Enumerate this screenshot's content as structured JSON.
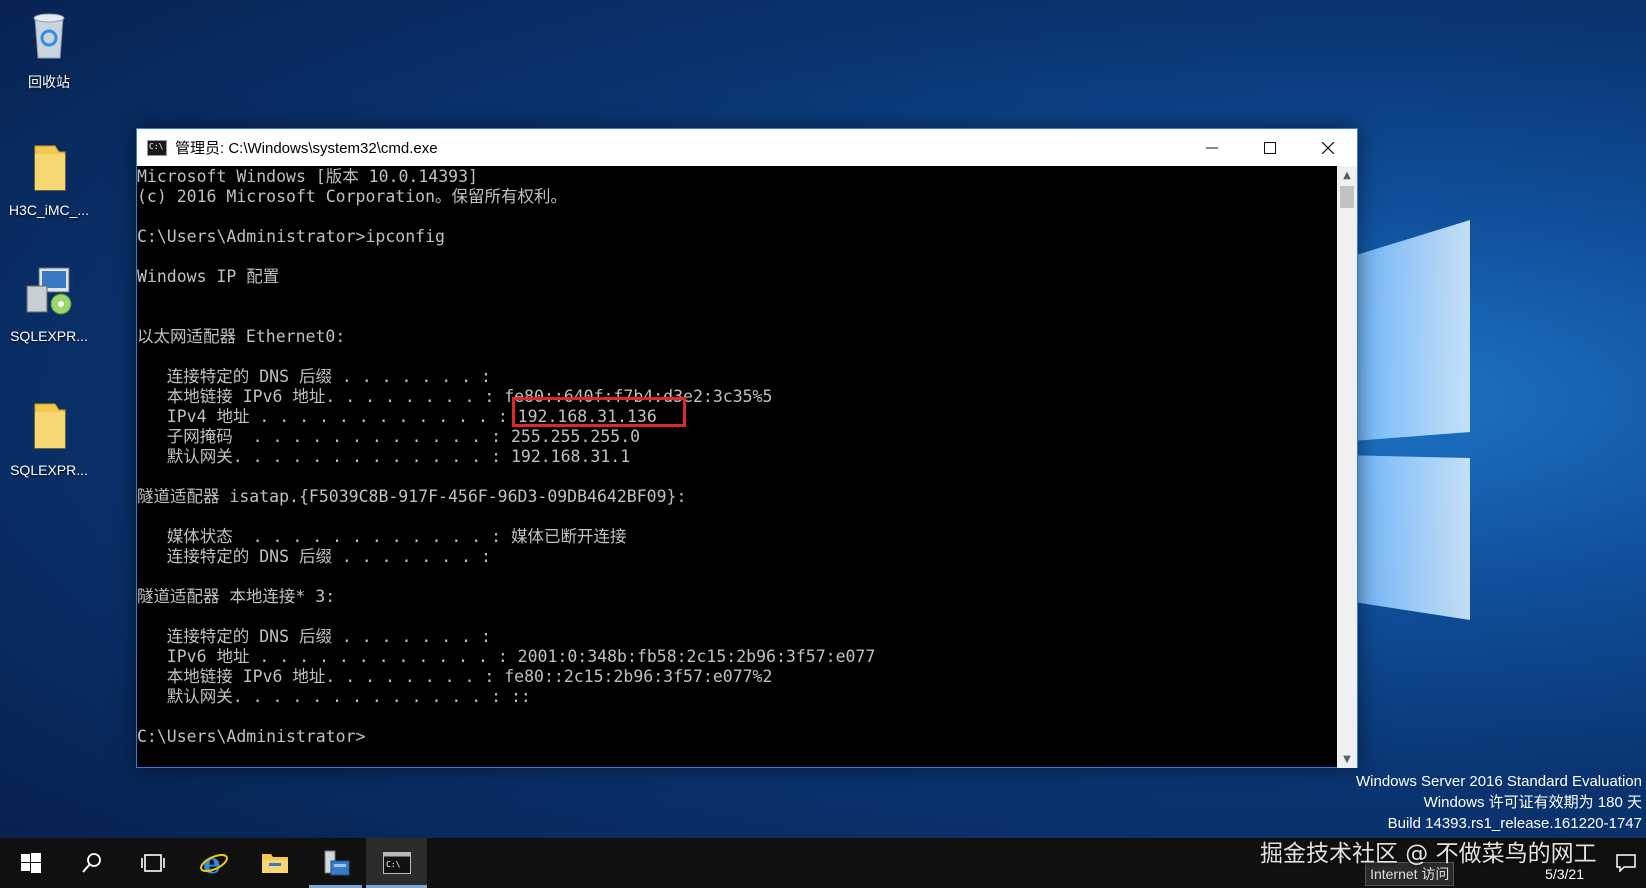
{
  "desktop": {
    "icons": [
      {
        "label": "回收站",
        "icon": "recycle-bin-icon"
      },
      {
        "label": "H3C_iMC_...",
        "icon": "folder-icon"
      },
      {
        "label": "SQLEXPR...",
        "icon": "installer-icon"
      },
      {
        "label": "SQLEXPR...",
        "icon": "folder-icon"
      }
    ],
    "system_info": [
      "Windows Server 2016 Standard Evaluation",
      "Windows 许可证有效期为 180 天",
      "Build 14393.rs1_release.161220-1747"
    ],
    "watermark": "掘金技术社区 @ 不做菜鸟的网工"
  },
  "cmd_window": {
    "title": "管理员: C:\\Windows\\system32\\cmd.exe",
    "console_lines": [
      "Microsoft Windows [版本 10.0.14393]",
      "(c) 2016 Microsoft Corporation。保留所有权利。",
      "",
      "C:\\Users\\Administrator>ipconfig",
      "",
      "Windows IP 配置",
      "",
      "",
      "以太网适配器 Ethernet0:",
      "",
      "   连接特定的 DNS 后缀 . . . . . . . :",
      "   本地链接 IPv6 地址. . . . . . . . : fe80::640f:f7b4:d3e2:3c35%5",
      "   IPv4 地址 . . . . . . . . . . . . : 192.168.31.136",
      "   子网掩码  . . . . . . . . . . . . : 255.255.255.0",
      "   默认网关. . . . . . . . . . . . . : 192.168.31.1",
      "",
      "隧道适配器 isatap.{F5039C8B-917F-456F-96D3-09DB4642BF09}:",
      "",
      "   媒体状态  . . . . . . . . . . . . : 媒体已断开连接",
      "   连接特定的 DNS 后缀 . . . . . . . :",
      "",
      "隧道适配器 本地连接* 3:",
      "",
      "   连接特定的 DNS 后缀 . . . . . . . :",
      "   IPv6 地址 . . . . . . . . . . . . : 2001:0:348b:fb58:2c15:2b96:3f57:e077",
      "   本地链接 IPv6 地址. . . . . . . . : fe80::2c15:2b96:3f57:e077%2",
      "   默认网关. . . . . . . . . . . . . : ::",
      "",
      "C:\\Users\\Administrator>"
    ],
    "highlighted_value": "192.168.31.136"
  },
  "taskbar": {
    "items": [
      {
        "name": "start-button",
        "icon": "windows-start-icon"
      },
      {
        "name": "search-button",
        "icon": "search-icon"
      },
      {
        "name": "task-view-button",
        "icon": "task-view-icon"
      },
      {
        "name": "ie-button",
        "icon": "internet-explorer-icon"
      },
      {
        "name": "file-explorer-button",
        "icon": "folder-icon"
      },
      {
        "name": "server-manager-button",
        "icon": "server-manager-icon"
      },
      {
        "name": "cmd-taskbar-button",
        "icon": "cmd-icon"
      }
    ],
    "tray": {
      "network_tooltip": "Internet 访问",
      "date": "5/3/21"
    }
  },
  "colors": {
    "console_bg": "#000000",
    "console_fg": "#c0c0c0",
    "highlight": "#e0262a",
    "taskbar_bg": "#101010"
  }
}
